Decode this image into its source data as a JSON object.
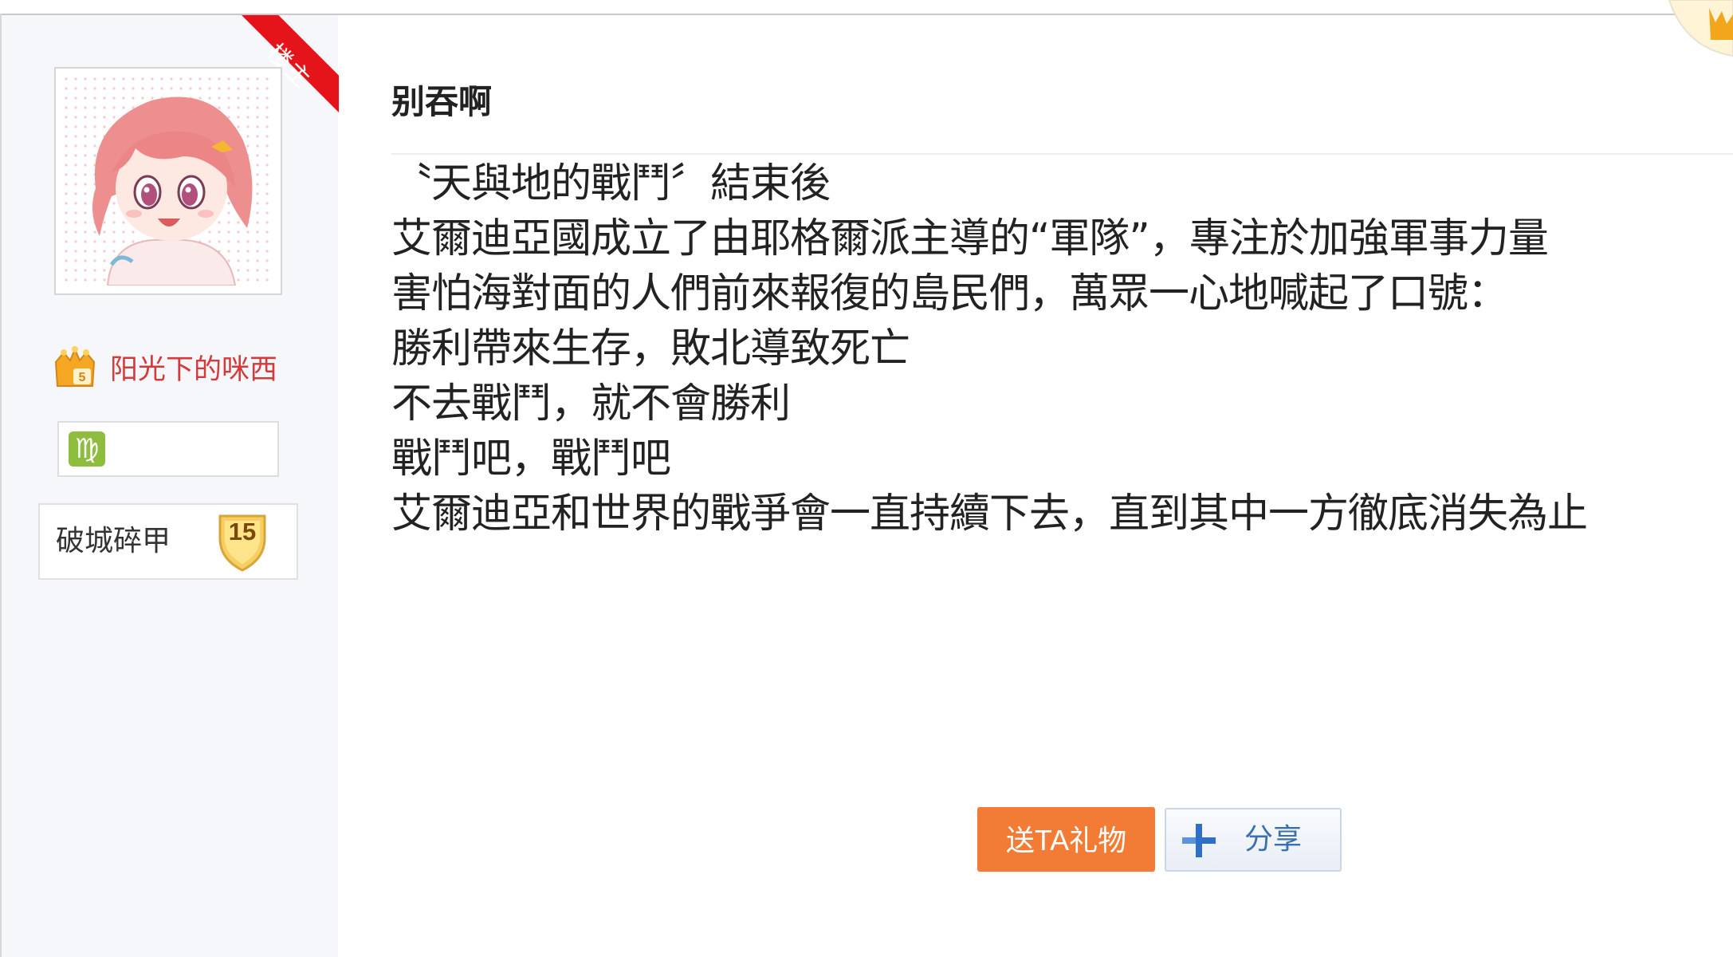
{
  "post": {
    "author": {
      "owner_badge": "楼主",
      "username": "阳光下的咪西",
      "rank_title": "破城碎甲",
      "level": "15",
      "avatar_icon": "anime-girl-avatar-icon",
      "vip_icon": "crown-vip-icon",
      "zodiac_icon": "virgo-icon",
      "zodiac_glyph": "♍"
    },
    "title": "别吞啊",
    "body_lines": [
      "〝天與地的戰鬥〞結束後",
      "艾爾迪亞國成立了由耶格爾派主導的“軍隊”，專注於加強軍事力量",
      "害怕海對面的人們前來報復的島民們，萬眾一心地喊起了口號：",
      "勝利帶來生存，敗北導致死亡",
      "不去戰鬥，就不會勝利",
      "戰鬥吧，戰鬥吧",
      "艾爾迪亞和世界的戰爭會一直持續下去，直到其中一方徹底消失為止"
    ],
    "actions": {
      "gift_label": "送TA礼物",
      "share_label": "分享",
      "share_icon": "plus-share-icon"
    }
  },
  "colors": {
    "owner_ribbon": "#e5141b",
    "username": "#d43a3a",
    "gift_button": "#f27c35",
    "share_text": "#3a6fb0",
    "sidebar_bg": "#f5f7fa"
  }
}
